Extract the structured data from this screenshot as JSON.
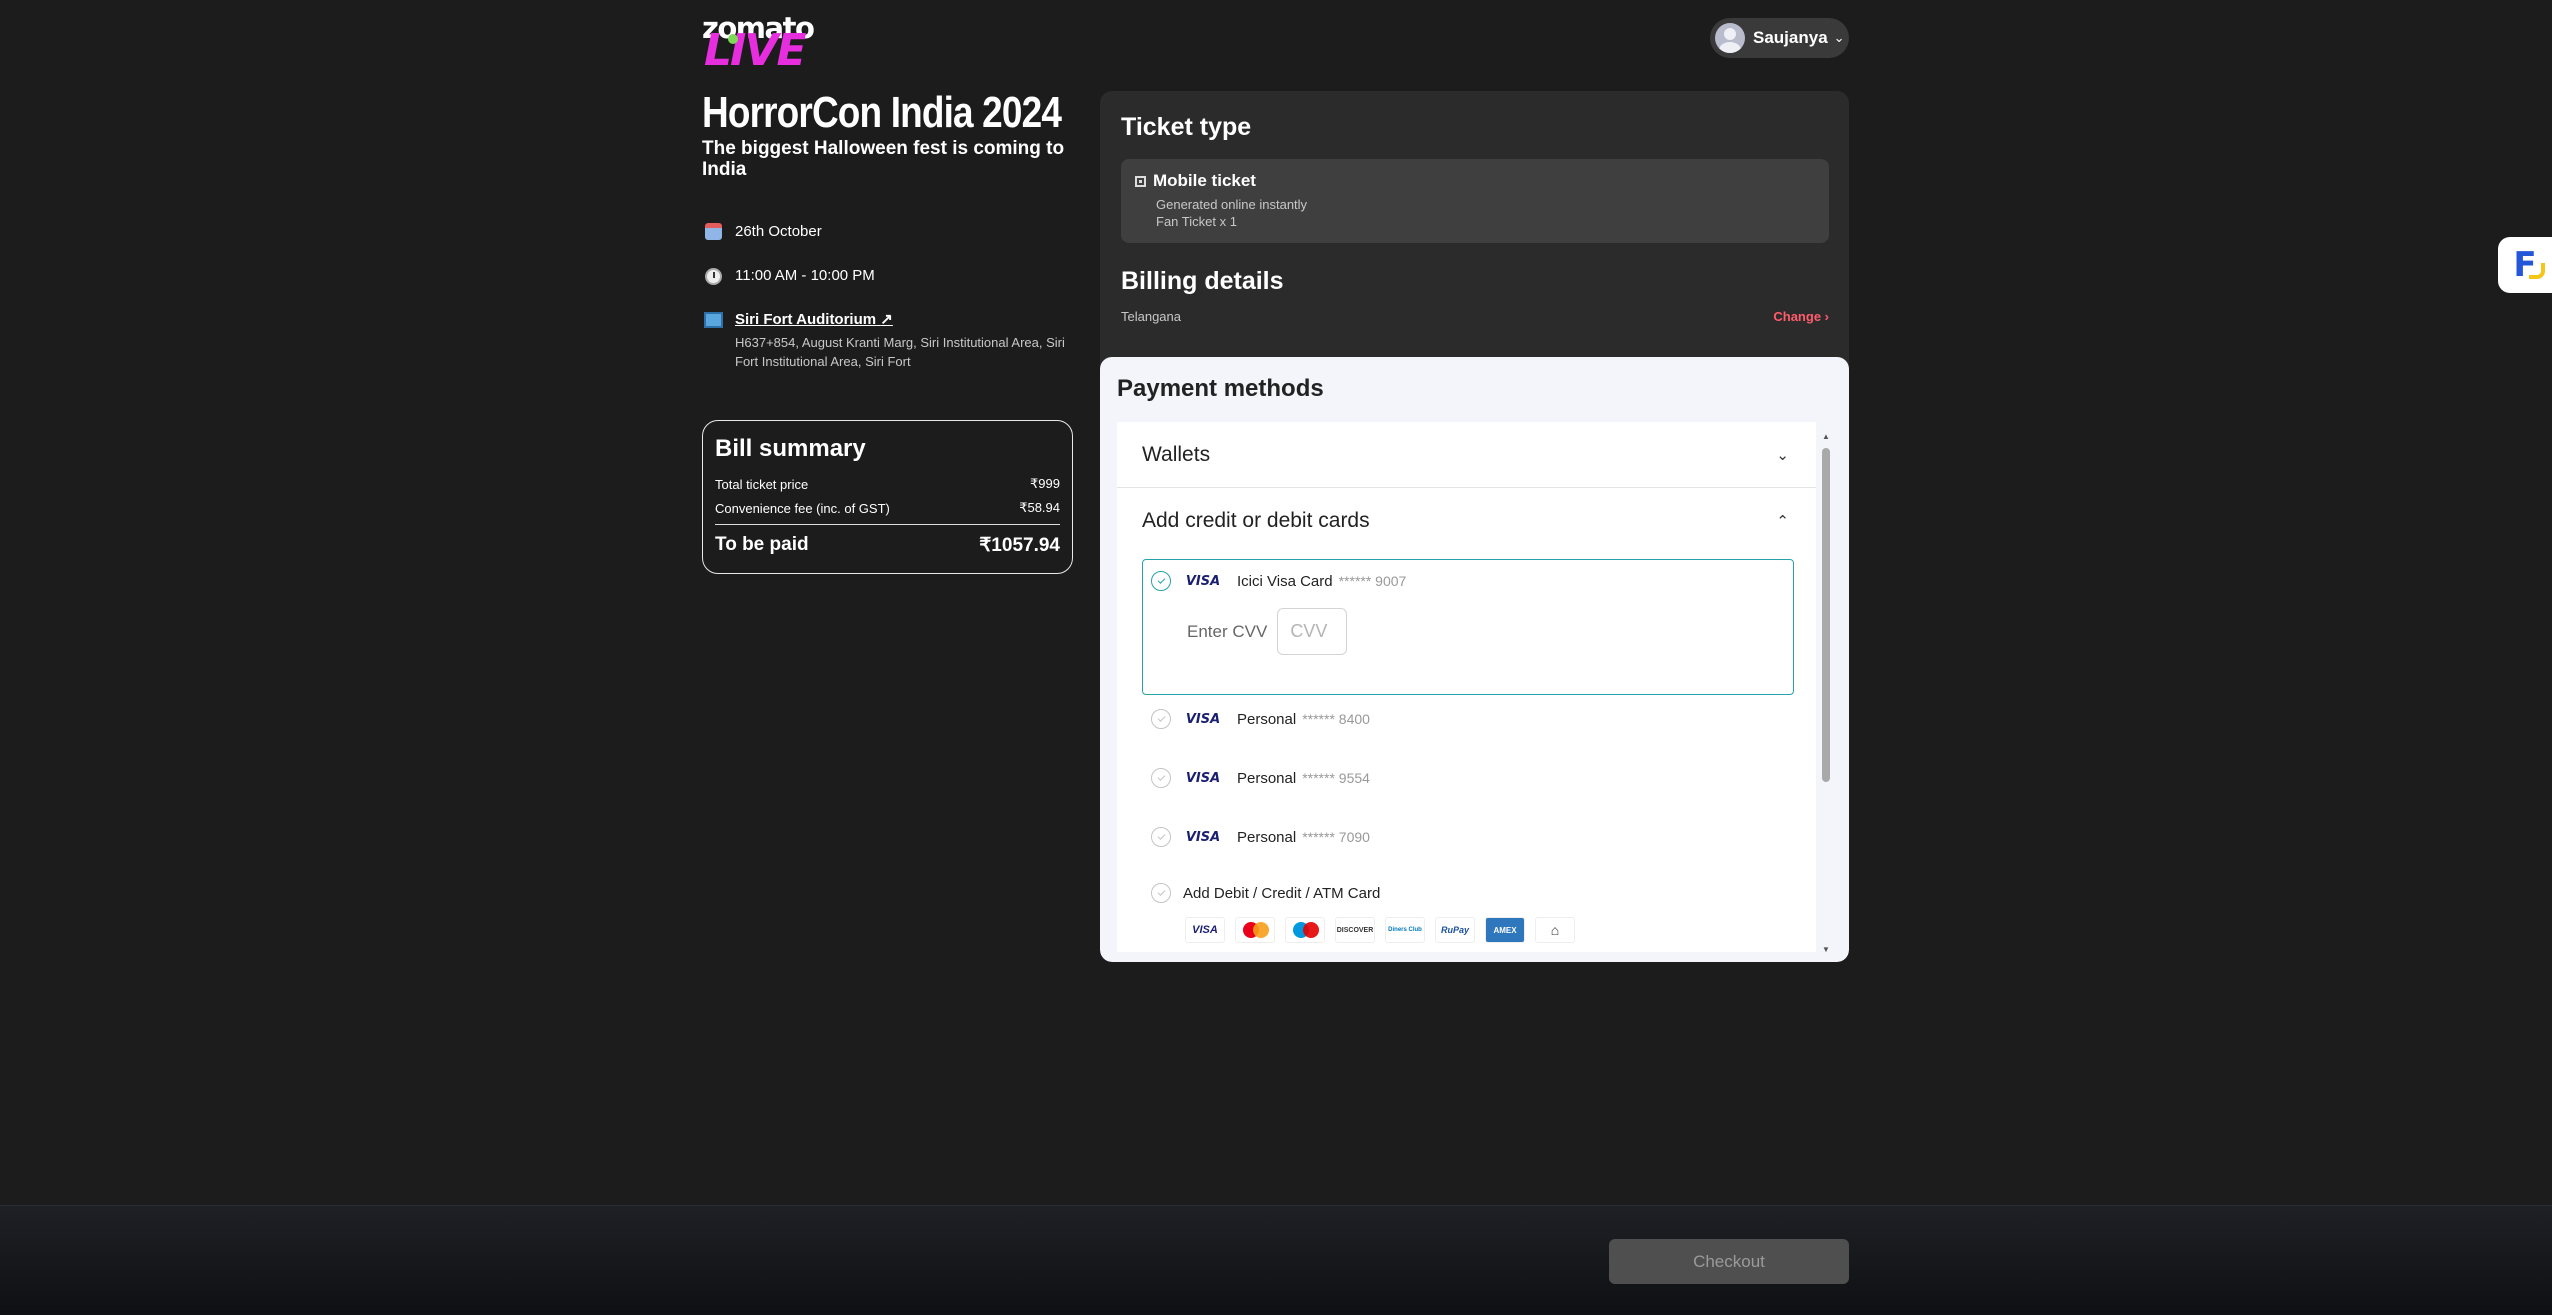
{
  "header": {
    "logo_text": "zomato",
    "logo_sub": "LIVE",
    "user_name": "Saujanya"
  },
  "event": {
    "title": "HorrorCon India 2024",
    "subtitle": "The biggest Halloween fest is coming to India",
    "date": "26th October",
    "time": "11:00 AM - 10:00 PM",
    "venue_name": "Siri Fort Auditorium",
    "venue_address": "H637+854, August Kranti Marg, Siri Institutional Area, Siri Fort Institutional Area, Siri Fort"
  },
  "bill": {
    "title": "Bill summary",
    "ticket_label": "Total ticket price",
    "ticket_value": "₹999",
    "fee_label": "Convenience fee (inc. of GST)",
    "fee_value": "₹58.94",
    "total_label": "To be paid",
    "total_value": "₹1057.94"
  },
  "ticket_type": {
    "title": "Ticket type",
    "name": "Mobile ticket",
    "desc": "Generated online instantly",
    "qty": "Fan Ticket x 1"
  },
  "billing": {
    "title": "Billing details",
    "state": "Telangana",
    "change_label": "Change ›"
  },
  "payment": {
    "title": "Payment methods",
    "wallets_label": "Wallets",
    "cards_label": "Add credit or debit cards",
    "cvv_label": "Enter CVV",
    "cvv_placeholder": "CVV",
    "add_card_label": "Add Debit / Credit / ATM Card",
    "cards": [
      {
        "brand": "VISA",
        "name": "Icici Visa Card",
        "masked": "****** 9007",
        "selected": true
      },
      {
        "brand": "VISA",
        "name": "Personal",
        "masked": "****** 8400",
        "selected": false
      },
      {
        "brand": "VISA",
        "name": "Personal",
        "masked": "****** 9554",
        "selected": false
      },
      {
        "brand": "VISA",
        "name": "Personal",
        "masked": "****** 7090",
        "selected": false
      }
    ],
    "network_logos": [
      "VISA",
      "Mastercard",
      "Maestro",
      "DISCOVER",
      "Diners Club",
      "RuPay",
      "AMEX",
      "Bank"
    ]
  },
  "footer": {
    "checkout_label": "Checkout"
  },
  "colors": {
    "accent_teal": "#27a2a8",
    "change_red": "#ff5c6c",
    "logo_pink": "#e62ede"
  }
}
